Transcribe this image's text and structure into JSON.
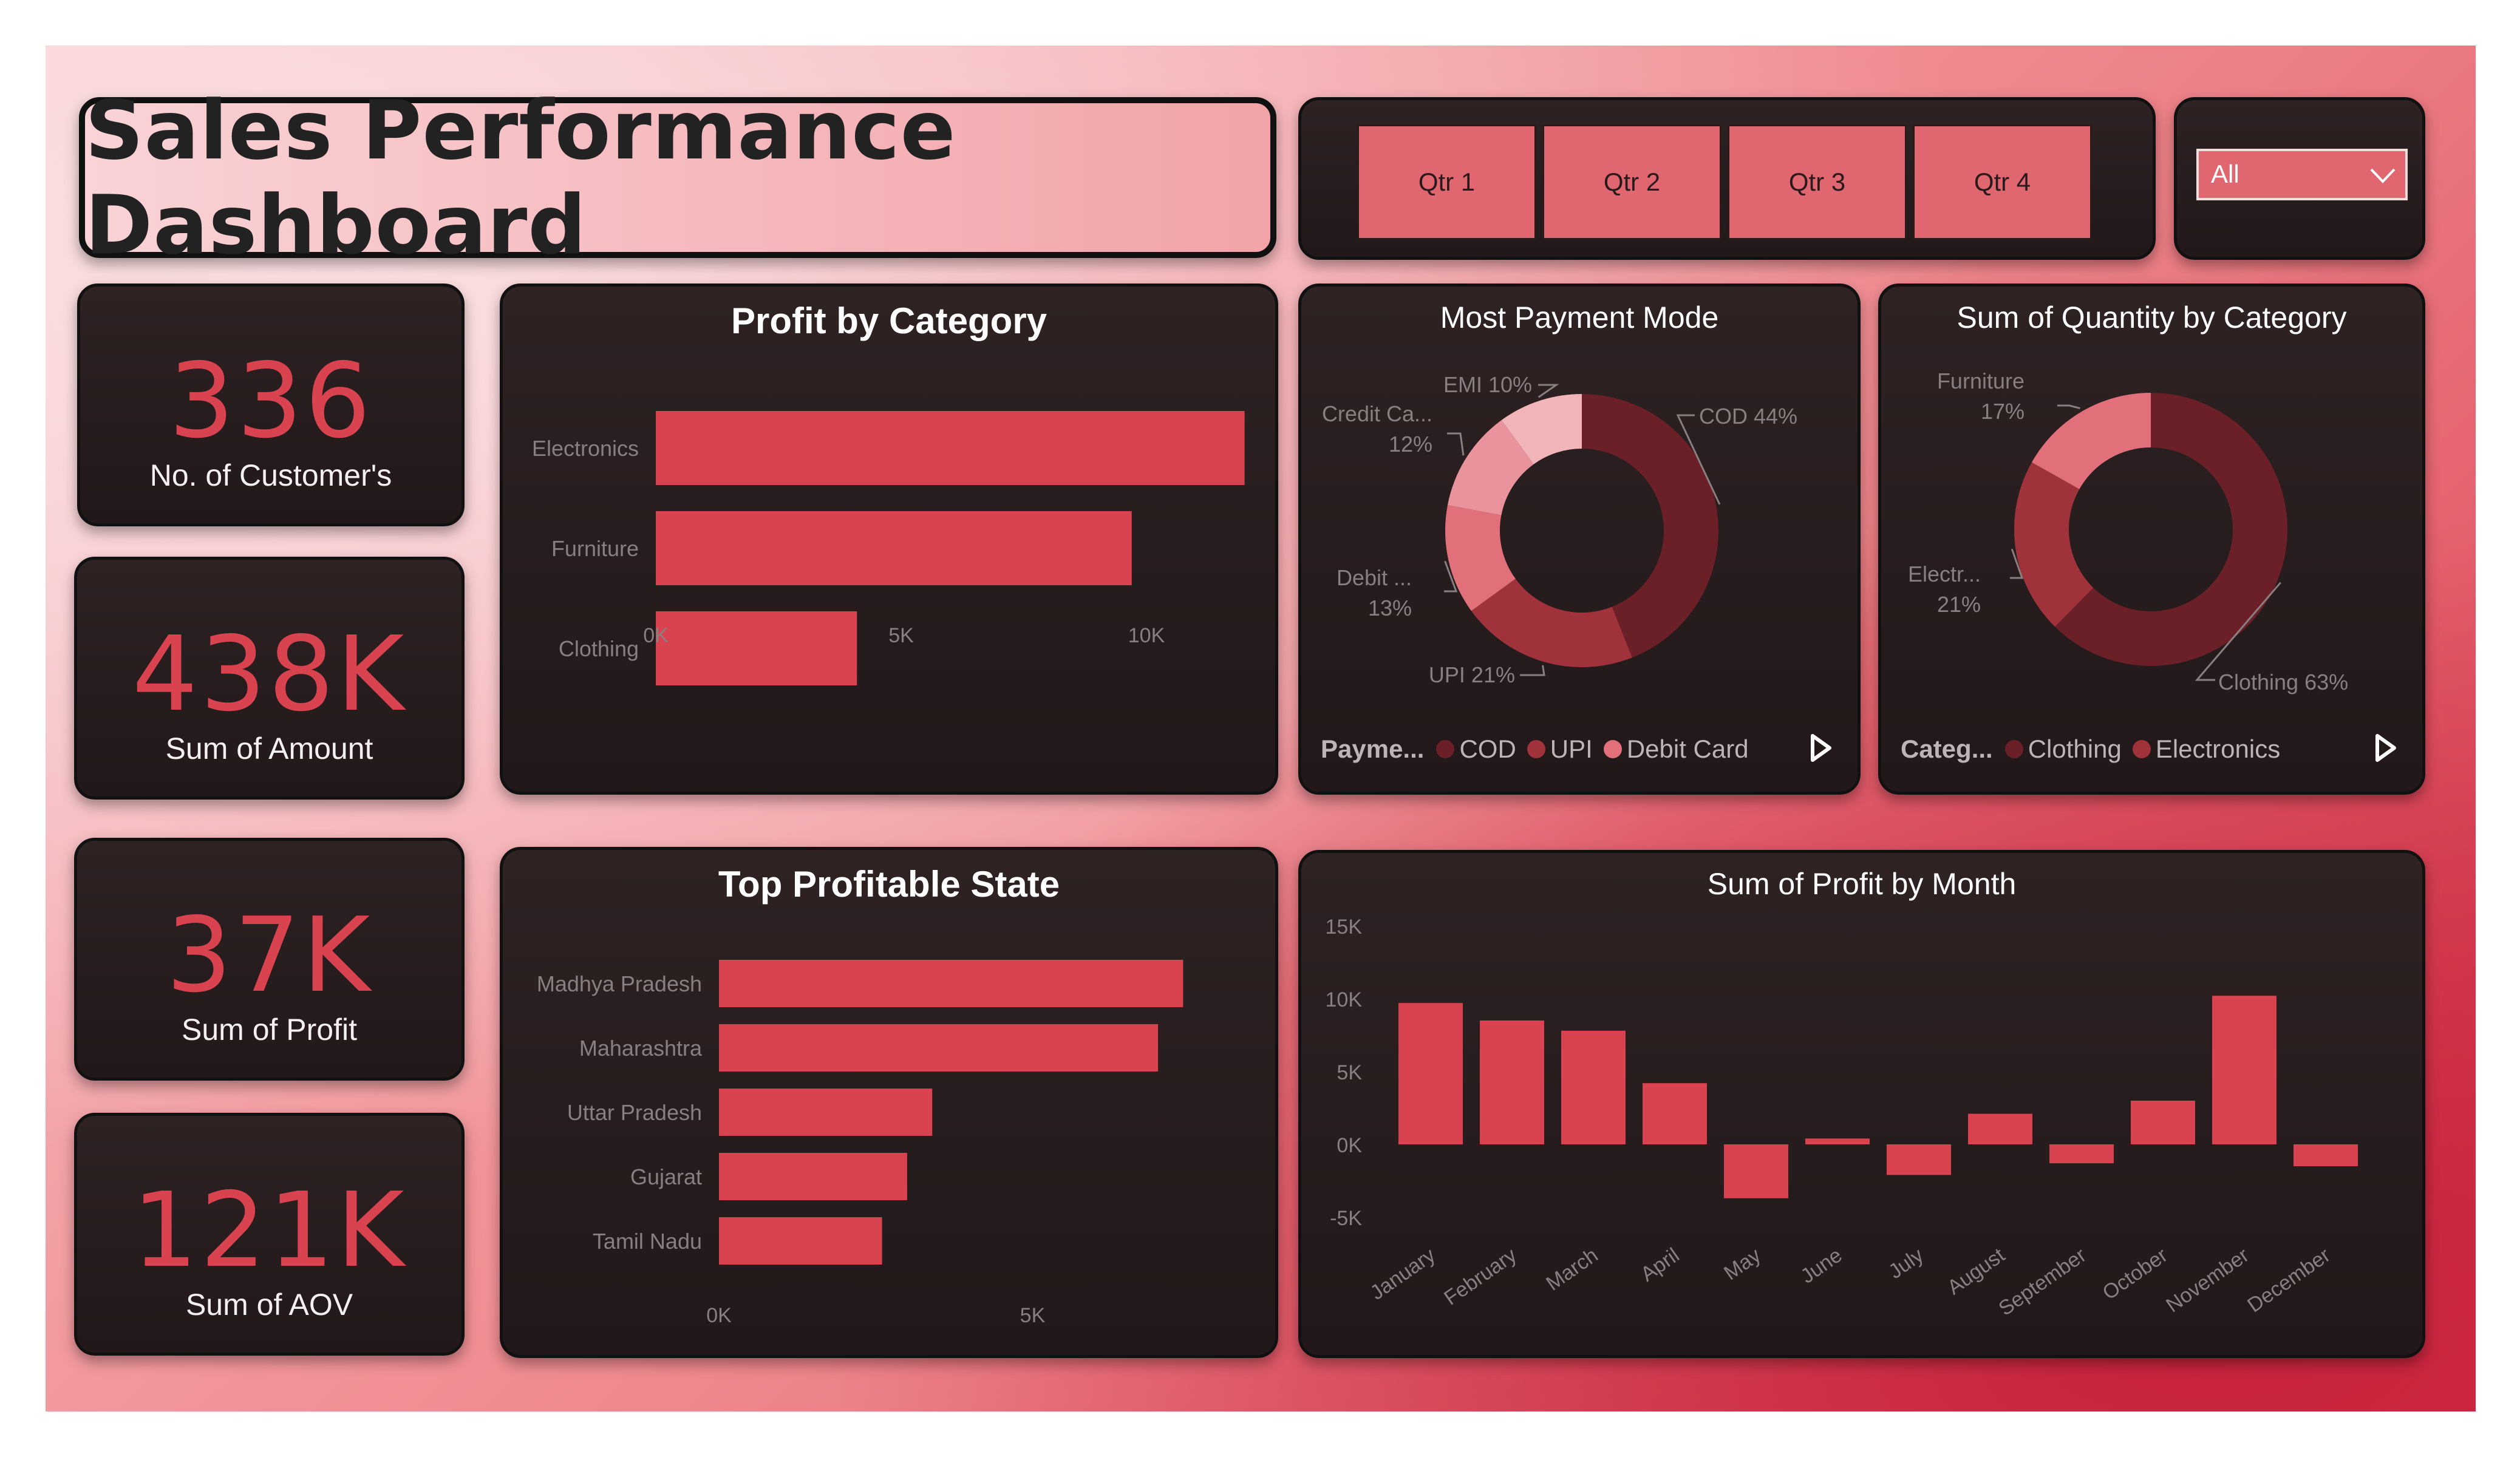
{
  "header": {
    "title": "Sales Performance Dashboard"
  },
  "slicers": {
    "quarters": [
      {
        "label": "Qtr 1"
      },
      {
        "label": "Qtr 2"
      },
      {
        "label": "Qtr 3"
      },
      {
        "label": "Qtr 4"
      }
    ],
    "dropdown": {
      "value": "All"
    }
  },
  "kpis": [
    {
      "value": "336",
      "label": "No. of Customer's"
    },
    {
      "value": "438K",
      "label": "Sum of Amount"
    },
    {
      "value": "37K",
      "label": "Sum of Profit"
    },
    {
      "value": "121K",
      "label": "Sum of AOV"
    }
  ],
  "colors": {
    "accent": "#d9434f",
    "dark_maroon": "#6b1f27",
    "mid_red": "#a0323b",
    "pink": "#e2707b",
    "light_pink": "#f1b4b9"
  },
  "chart_data": [
    {
      "id": "profit_by_category",
      "type": "bar",
      "orientation": "horizontal",
      "title": "Profit by Category",
      "categories": [
        "Electronics",
        "Furniture",
        "Clothing"
      ],
      "values": [
        12000,
        9700,
        4100
      ],
      "xlim": [
        0,
        12500
      ],
      "xticks": [
        {
          "value": 0,
          "label": "0K"
        },
        {
          "value": 5000,
          "label": "5K"
        },
        {
          "value": 10000,
          "label": "10K"
        }
      ],
      "grid": false
    },
    {
      "id": "most_payment_mode",
      "type": "pie",
      "donut": true,
      "title": "Most Payment Mode",
      "slices": [
        {
          "label": "COD 44%",
          "value": 44,
          "color": "#6b1f27"
        },
        {
          "label": "UPI 21%",
          "value": 21,
          "color": "#a0323b"
        },
        {
          "label": "Debit ... 13%",
          "value": 13,
          "color": "#e2707b"
        },
        {
          "label": "Credit Ca... 12%",
          "value": 12,
          "color": "#e9949c"
        },
        {
          "label": "EMI 10%",
          "value": 10,
          "color": "#f1b4b9"
        }
      ],
      "legend": {
        "title": "Payme...",
        "items": [
          {
            "label": "COD",
            "color": "#6b1f27"
          },
          {
            "label": "UPI",
            "color": "#a0323b"
          },
          {
            "label": "Debit Card",
            "color": "#e2707b"
          }
        ],
        "placement": "bottom"
      }
    },
    {
      "id": "sum_quantity_by_category",
      "type": "pie",
      "donut": true,
      "title": "Sum of Quantity by Category",
      "slices": [
        {
          "label": "Clothing 63%",
          "value": 63,
          "color": "#6b1f27"
        },
        {
          "label": "Electr... 21%",
          "value": 21,
          "color": "#a0323b"
        },
        {
          "label": "Furniture 17%",
          "value": 17,
          "color": "#e2707b"
        }
      ],
      "legend": {
        "title": "Categ...",
        "items": [
          {
            "label": "Clothing",
            "color": "#6b1f27"
          },
          {
            "label": "Electronics",
            "color": "#a0323b"
          }
        ],
        "placement": "bottom"
      }
    },
    {
      "id": "top_profitable_state",
      "type": "bar",
      "orientation": "horizontal",
      "title": "Top Profitable State",
      "categories": [
        "Madhya Pradesh",
        "Maharashtra",
        "Uttar Pradesh",
        "Gujarat",
        "Tamil Nadu"
      ],
      "values": [
        7400,
        7000,
        3400,
        3000,
        2600
      ],
      "xlim": [
        0,
        8500
      ],
      "xticks": [
        {
          "value": 0,
          "label": "0K"
        },
        {
          "value": 5000,
          "label": "5K"
        }
      ],
      "grid": false
    },
    {
      "id": "sum_profit_by_month",
      "type": "bar",
      "orientation": "vertical",
      "title": "Sum of Profit by Month",
      "categories": [
        "January",
        "February",
        "March",
        "April",
        "May",
        "June",
        "July",
        "August",
        "September",
        "October",
        "November",
        "December"
      ],
      "values": [
        9700,
        8500,
        7800,
        4200,
        -3700,
        400,
        -2100,
        2100,
        -1300,
        3000,
        10200,
        -1500
      ],
      "ylim": [
        -5000,
        15000
      ],
      "yticks": [
        {
          "value": -5000,
          "label": "-5K"
        },
        {
          "value": 0,
          "label": "0K"
        },
        {
          "value": 5000,
          "label": "5K"
        },
        {
          "value": 10000,
          "label": "10K"
        },
        {
          "value": 15000,
          "label": "15K"
        }
      ],
      "grid": false
    }
  ]
}
